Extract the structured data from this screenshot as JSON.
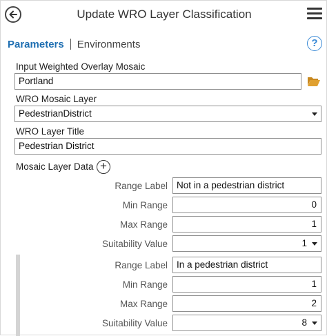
{
  "header": {
    "title": "Update WRO Layer Classification"
  },
  "tabs": {
    "parameters": "Parameters",
    "environments": "Environments"
  },
  "help": {
    "glyph": "?"
  },
  "fields": {
    "mosaic": {
      "label": "Input Weighted Overlay Mosaic",
      "value": "Portland"
    },
    "layer": {
      "label": "WRO Mosaic Layer",
      "value": "PedestrianDistrict"
    },
    "title": {
      "label": "WRO Layer Title",
      "value": "Pedestrian District"
    }
  },
  "mosaic_layer_data": {
    "label": "Mosaic Layer Data",
    "add_glyph": "+",
    "labels": {
      "range_label": "Range Label",
      "min_range": "Min Range",
      "max_range": "Max Range",
      "suitability": "Suitability Value"
    },
    "rows": [
      {
        "range_label": "Not in a pedestrian district",
        "min_range": "0",
        "max_range": "1",
        "suitability": "1"
      },
      {
        "range_label": "In a pedestrian district",
        "min_range": "1",
        "max_range": "2",
        "suitability": "8"
      }
    ]
  },
  "colors": {
    "accent": "#1f6fb2",
    "help": "#3a8ad6",
    "folder": "#e0a030"
  },
  "icons": [
    "back-arrow-icon",
    "hamburger-menu-icon",
    "help-icon",
    "folder-open-icon",
    "plus-circle-icon",
    "dropdown-caret-icon"
  ]
}
